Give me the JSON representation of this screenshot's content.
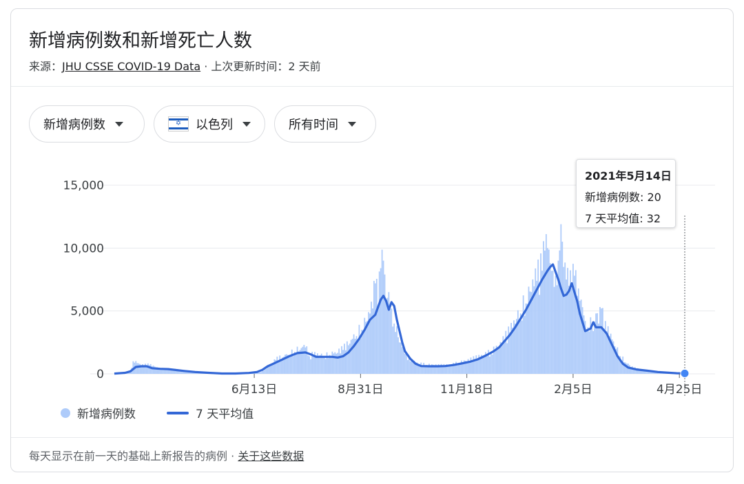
{
  "header": {
    "title": "新增病例数和新增死亡人数",
    "source_prefix": "来源：",
    "source_link": "JHU CSSE COVID-19 Data",
    "source_suffix": " · 上次更新时间：2 天前"
  },
  "filters": {
    "metric": "新增病例数",
    "region": "以色列",
    "range": "所有时间"
  },
  "tooltip": {
    "date": "2021年5月14日",
    "cases": "新增病例数: 20",
    "average": "7 天平均值: 32"
  },
  "legend": {
    "bars": "新增病例数",
    "line": "7 天平均值"
  },
  "footer": {
    "note": "每天显示在前一天的基础上新报告的病例",
    "separator": " · ",
    "link": "关于这些数据"
  },
  "colors": {
    "bars": "#aecbfa",
    "line": "#3367d6",
    "grid": "#e8eaed"
  },
  "chart_data": {
    "type": "bar",
    "ylim": [
      0,
      15000
    ],
    "y_ticks": [
      "0",
      "5,000",
      "10,000",
      "15,000"
    ],
    "y_tick_values": [
      0,
      5000,
      10000,
      15000
    ],
    "x_ticks": [
      "6月13日",
      "8月31日",
      "11月18日",
      "2月5日",
      "4月25日"
    ],
    "x_tick_days": [
      104,
      183,
      262,
      341,
      420
    ],
    "x_day_range": [
      0,
      424
    ],
    "grid": true,
    "legend_position": "bottom-left",
    "series": [
      {
        "name": "新增病例数",
        "kind": "bar",
        "points": [
          [
            0,
            20
          ],
          [
            12,
            150
          ],
          [
            14,
            1000
          ],
          [
            20,
            650
          ],
          [
            26,
            700
          ],
          [
            34,
            380
          ],
          [
            42,
            380
          ],
          [
            52,
            250
          ],
          [
            62,
            120
          ],
          [
            72,
            40
          ],
          [
            80,
            10
          ],
          [
            90,
            15
          ],
          [
            100,
            80
          ],
          [
            108,
            120
          ],
          [
            112,
            350
          ],
          [
            116,
            600
          ],
          [
            120,
            1100
          ],
          [
            125,
            1300
          ],
          [
            130,
            1500
          ],
          [
            134,
            1750
          ],
          [
            138,
            1900
          ],
          [
            142,
            2100
          ],
          [
            145,
            1400
          ],
          [
            148,
            1500
          ],
          [
            152,
            1450
          ],
          [
            156,
            1350
          ],
          [
            160,
            1500
          ],
          [
            165,
            1600
          ],
          [
            170,
            1900
          ],
          [
            175,
            2400
          ],
          [
            180,
            3000
          ],
          [
            184,
            3500
          ],
          [
            188,
            4200
          ],
          [
            192,
            5200
          ],
          [
            194,
            7200
          ],
          [
            196,
            5400
          ],
          [
            198,
            8400
          ],
          [
            200,
            9000
          ],
          [
            202,
            5800
          ],
          [
            204,
            6500
          ],
          [
            206,
            5200
          ],
          [
            208,
            4000
          ],
          [
            212,
            2500
          ],
          [
            216,
            1600
          ],
          [
            220,
            1000
          ],
          [
            226,
            800
          ],
          [
            232,
            700
          ],
          [
            240,
            650
          ],
          [
            246,
            650
          ],
          [
            250,
            700
          ],
          [
            256,
            850
          ],
          [
            262,
            1000
          ],
          [
            268,
            1200
          ],
          [
            274,
            1400
          ],
          [
            280,
            1700
          ],
          [
            286,
            2100
          ],
          [
            290,
            2700
          ],
          [
            294,
            3300
          ],
          [
            298,
            4000
          ],
          [
            302,
            4800
          ],
          [
            306,
            5600
          ],
          [
            310,
            6500
          ],
          [
            314,
            7400
          ],
          [
            318,
            8200
          ],
          [
            320,
            9800
          ],
          [
            322,
            10000
          ],
          [
            324,
            8800
          ],
          [
            326,
            8200
          ],
          [
            328,
            7800
          ],
          [
            330,
            9000
          ],
          [
            332,
            11900
          ],
          [
            334,
            8500
          ],
          [
            336,
            7500
          ],
          [
            338,
            7000
          ],
          [
            340,
            6800
          ],
          [
            342,
            7800
          ],
          [
            344,
            6200
          ],
          [
            346,
            5800
          ],
          [
            348,
            5300
          ],
          [
            350,
            4200
          ],
          [
            352,
            3700
          ],
          [
            354,
            4500
          ],
          [
            356,
            3400
          ],
          [
            358,
            4800
          ],
          [
            360,
            4000
          ],
          [
            362,
            5200
          ],
          [
            364,
            3600
          ],
          [
            366,
            3400
          ],
          [
            368,
            3000
          ],
          [
            372,
            2200
          ],
          [
            376,
            1400
          ],
          [
            380,
            900
          ],
          [
            384,
            550
          ],
          [
            388,
            400
          ],
          [
            394,
            250
          ],
          [
            400,
            180
          ],
          [
            408,
            120
          ],
          [
            416,
            70
          ],
          [
            424,
            20
          ]
        ]
      },
      {
        "name": "7 天平均值",
        "kind": "line",
        "points": [
          [
            0,
            20
          ],
          [
            8,
            80
          ],
          [
            12,
            200
          ],
          [
            16,
            550
          ],
          [
            20,
            600
          ],
          [
            24,
            600
          ],
          [
            28,
            450
          ],
          [
            34,
            400
          ],
          [
            40,
            380
          ],
          [
            46,
            300
          ],
          [
            52,
            230
          ],
          [
            60,
            150
          ],
          [
            70,
            80
          ],
          [
            80,
            30
          ],
          [
            90,
            30
          ],
          [
            100,
            70
          ],
          [
            106,
            150
          ],
          [
            110,
            320
          ],
          [
            114,
            600
          ],
          [
            118,
            800
          ],
          [
            124,
            1100
          ],
          [
            130,
            1400
          ],
          [
            136,
            1650
          ],
          [
            142,
            1700
          ],
          [
            146,
            1550
          ],
          [
            150,
            1350
          ],
          [
            156,
            1350
          ],
          [
            162,
            1350
          ],
          [
            166,
            1300
          ],
          [
            170,
            1400
          ],
          [
            174,
            1700
          ],
          [
            178,
            2200
          ],
          [
            182,
            2800
          ],
          [
            186,
            3500
          ],
          [
            190,
            4300
          ],
          [
            194,
            4700
          ],
          [
            198,
            5900
          ],
          [
            200,
            6200
          ],
          [
            202,
            5800
          ],
          [
            204,
            5100
          ],
          [
            206,
            5700
          ],
          [
            208,
            5400
          ],
          [
            210,
            4300
          ],
          [
            212,
            3400
          ],
          [
            214,
            2500
          ],
          [
            216,
            1800
          ],
          [
            220,
            1200
          ],
          [
            224,
            800
          ],
          [
            228,
            620
          ],
          [
            234,
            600
          ],
          [
            240,
            600
          ],
          [
            246,
            620
          ],
          [
            252,
            700
          ],
          [
            258,
            820
          ],
          [
            264,
            950
          ],
          [
            270,
            1150
          ],
          [
            276,
            1450
          ],
          [
            282,
            1800
          ],
          [
            286,
            2100
          ],
          [
            290,
            2600
          ],
          [
            294,
            3100
          ],
          [
            298,
            3700
          ],
          [
            302,
            4400
          ],
          [
            306,
            5100
          ],
          [
            310,
            5900
          ],
          [
            314,
            6700
          ],
          [
            318,
            7500
          ],
          [
            322,
            8200
          ],
          [
            324,
            8500
          ],
          [
            326,
            8700
          ],
          [
            328,
            8100
          ],
          [
            330,
            7500
          ],
          [
            332,
            6800
          ],
          [
            334,
            6200
          ],
          [
            336,
            6300
          ],
          [
            338,
            6600
          ],
          [
            340,
            7200
          ],
          [
            342,
            6500
          ],
          [
            344,
            5800
          ],
          [
            346,
            4800
          ],
          [
            350,
            3400
          ],
          [
            354,
            3600
          ],
          [
            356,
            4100
          ],
          [
            358,
            3700
          ],
          [
            362,
            3700
          ],
          [
            366,
            3200
          ],
          [
            370,
            2300
          ],
          [
            374,
            1400
          ],
          [
            378,
            800
          ],
          [
            382,
            500
          ],
          [
            388,
            350
          ],
          [
            396,
            250
          ],
          [
            404,
            150
          ],
          [
            412,
            90
          ],
          [
            418,
            50
          ],
          [
            424,
            32
          ]
        ]
      }
    ]
  }
}
